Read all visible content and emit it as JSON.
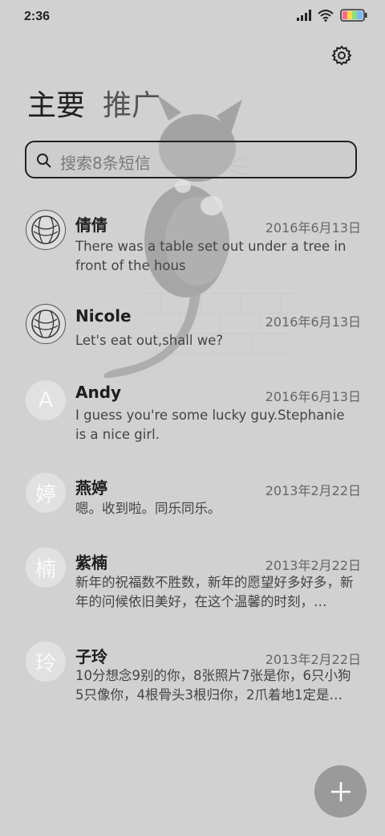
{
  "status_bar": {
    "time": "2:36"
  },
  "header": {
    "tabs": [
      {
        "label": "主要",
        "active": true
      },
      {
        "label": "推广",
        "active": false
      }
    ]
  },
  "search": {
    "placeholder": "搜索8条短信"
  },
  "messages": [
    {
      "avatar_type": "yarn-icon",
      "avatar_text": "",
      "name": "倩倩",
      "date": "2016年6月13日",
      "preview": "There was a table set out under a tree in front of the hous"
    },
    {
      "avatar_type": "yarn-icon",
      "avatar_text": "",
      "name": "Nicole",
      "date": "2016年6月13日",
      "preview": "Let's eat out,shall we?"
    },
    {
      "avatar_type": "letter",
      "avatar_text": "A",
      "name": "Andy",
      "date": "2016年6月13日",
      "preview": "I guess you're some lucky guy.Stephanie is a nice girl."
    },
    {
      "avatar_type": "letter",
      "avatar_text": "婷",
      "name": "燕婷",
      "date": "2013年2月22日",
      "preview": "嗯。收到啦。同乐同乐。"
    },
    {
      "avatar_type": "letter",
      "avatar_text": "楠",
      "name": "紫楠",
      "date": "2013年2月22日",
      "preview": "新年的祝福数不胜数，新年的愿望好多好多，新年的问候依旧美好，在这个温馨的时刻，…"
    },
    {
      "avatar_type": "letter",
      "avatar_text": "玲",
      "name": "子玲",
      "date": "2013年2月22日",
      "preview": "10分想念9别的你，8张照片7张是你，6只小狗5只像你，4根骨头3根归你，2爪着地1定是…"
    }
  ],
  "icons": {
    "settings": "gear-icon",
    "search": "search-icon",
    "fab": "plus-icon",
    "signal": "signal-icon",
    "wifi": "wifi-icon",
    "battery": "battery-icon"
  },
  "colors": {
    "background": "#d1d1d1",
    "fab": "#9a9a9a",
    "avatar": "#e1e1e1"
  }
}
